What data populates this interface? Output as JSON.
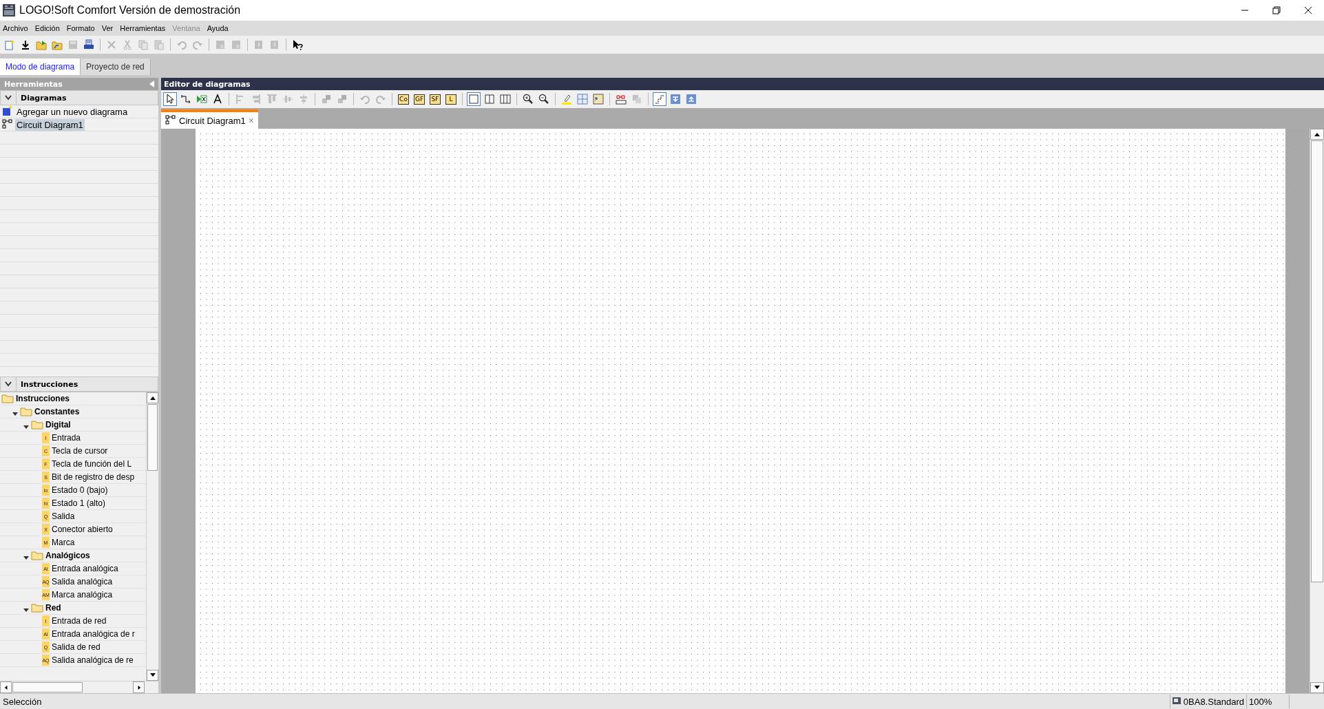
{
  "window": {
    "title": "LOGO!Soft Comfort Versión de demostración"
  },
  "menu": [
    {
      "label": "Archivo",
      "disabled": false
    },
    {
      "label": "Edición",
      "disabled": false
    },
    {
      "label": "Formato",
      "disabled": false
    },
    {
      "label": "Ver",
      "disabled": false
    },
    {
      "label": "Herramientas",
      "disabled": false
    },
    {
      "label": "Ventana",
      "disabled": true
    },
    {
      "label": "Ayuda",
      "disabled": false
    }
  ],
  "toolbar": [
    {
      "kind": "new",
      "disabled": false
    },
    {
      "kind": "download",
      "disabled": false
    },
    {
      "kind": "open",
      "disabled": false
    },
    {
      "kind": "import",
      "disabled": false
    },
    {
      "kind": "save",
      "disabled": true
    },
    {
      "kind": "print",
      "disabled": false
    },
    {
      "kind": "separator"
    },
    {
      "kind": "delete",
      "disabled": true
    },
    {
      "kind": "cut",
      "disabled": true
    },
    {
      "kind": "copy",
      "disabled": true
    },
    {
      "kind": "paste",
      "disabled": true
    },
    {
      "kind": "separator"
    },
    {
      "kind": "undo",
      "disabled": true
    },
    {
      "kind": "redo",
      "disabled": true
    },
    {
      "kind": "separator"
    },
    {
      "kind": "block",
      "disabled": true
    },
    {
      "kind": "block",
      "disabled": true
    },
    {
      "kind": "separator"
    },
    {
      "kind": "transfer",
      "disabled": true
    },
    {
      "kind": "transfer",
      "disabled": true
    },
    {
      "kind": "separator"
    },
    {
      "kind": "help",
      "disabled": false
    }
  ],
  "mode_tabs": [
    {
      "label": "Modo de diagrama",
      "selected": true
    },
    {
      "label": "Proyecto de red",
      "selected": false
    }
  ],
  "tools_panel": {
    "title": "Herramientas",
    "diagrams": {
      "title": "Diagramas",
      "expanded": true,
      "items": [
        {
          "kind": "add",
          "label": "Agregar un nuevo diagrama",
          "selected": false
        },
        {
          "kind": "diagram",
          "label": "Circuit Diagram1",
          "selected": true
        }
      ]
    },
    "instructions": {
      "title": "Instrucciones",
      "expanded": true,
      "tree": [
        {
          "label": "Instrucciones",
          "expanded": true,
          "children": [
            {
              "label": "Constantes",
              "expanded": true,
              "children": [
                {
                  "label": "Digital",
                  "expanded": true,
                  "children": [
                    {
                      "badge": "I",
                      "label": "Entrada"
                    },
                    {
                      "badge": "C",
                      "label": "Tecla de cursor"
                    },
                    {
                      "badge": "F",
                      "label": "Tecla de función del L"
                    },
                    {
                      "badge": "S",
                      "label": "Bit de registro de desp"
                    },
                    {
                      "badge": "lo",
                      "label": "Estado 0 (bajo)"
                    },
                    {
                      "badge": "hi",
                      "label": "Estado 1 (alto)"
                    },
                    {
                      "badge": "Q",
                      "label": "Salida"
                    },
                    {
                      "badge": "X",
                      "label": "Conector abierto"
                    },
                    {
                      "badge": "M",
                      "label": "Marca"
                    }
                  ]
                },
                {
                  "label": "Analógicos",
                  "expanded": true,
                  "children": [
                    {
                      "badge": "AI",
                      "label": "Entrada analógica"
                    },
                    {
                      "badge": "AQ",
                      "label": "Salida analógica"
                    },
                    {
                      "badge": "AM",
                      "label": "Marca analógica"
                    }
                  ]
                },
                {
                  "label": "Red",
                  "expanded": true,
                  "children": [
                    {
                      "badge": "I",
                      "label": "Entrada de red"
                    },
                    {
                      "badge": "AI",
                      "label": "Entrada analógica de r"
                    },
                    {
                      "badge": "Q",
                      "label": "Salida de red"
                    },
                    {
                      "badge": "AQ",
                      "label": "Salida analógica de re"
                    }
                  ]
                }
              ]
            }
          ]
        }
      ]
    }
  },
  "editor": {
    "title": "Editor de diagramas",
    "toolbar": [
      {
        "kind": "select",
        "selected": true,
        "disabled": false
      },
      {
        "kind": "connect",
        "selected": false,
        "disabled": false
      },
      {
        "kind": "insert",
        "selected": false,
        "disabled": false
      },
      {
        "kind": "text-tool",
        "selected": false,
        "disabled": false
      },
      {
        "kind": "separator"
      },
      {
        "kind": "align-left",
        "selected": false,
        "disabled": true
      },
      {
        "kind": "align-right",
        "selected": false,
        "disabled": true
      },
      {
        "kind": "align-top",
        "selected": false,
        "disabled": true
      },
      {
        "kind": "align-middle",
        "selected": false,
        "disabled": true
      },
      {
        "kind": "align-center",
        "selected": false,
        "disabled": true
      },
      {
        "kind": "separator"
      },
      {
        "kind": "arrange",
        "selected": false,
        "disabled": true
      },
      {
        "kind": "arrange",
        "selected": false,
        "disabled": true
      },
      {
        "kind": "separator"
      },
      {
        "kind": "undo",
        "selected": false,
        "disabled": true
      },
      {
        "kind": "redo",
        "selected": false,
        "disabled": true
      },
      {
        "kind": "separator"
      },
      {
        "kind": "label",
        "label": "Co",
        "selected": false,
        "disabled": false
      },
      {
        "kind": "label",
        "label": "GF",
        "selected": false,
        "disabled": false
      },
      {
        "kind": "label",
        "label": "SF",
        "selected": false,
        "disabled": false
      },
      {
        "kind": "label",
        "label": "L",
        "selected": false,
        "disabled": false
      },
      {
        "kind": "separator"
      },
      {
        "kind": "view-one",
        "selected": true,
        "disabled": false
      },
      {
        "kind": "view-two",
        "selected": false,
        "disabled": false
      },
      {
        "kind": "view-three",
        "selected": false,
        "disabled": false
      },
      {
        "kind": "separator"
      },
      {
        "kind": "zoom-in",
        "selected": false,
        "disabled": false
      },
      {
        "kind": "zoom-out",
        "selected": false,
        "disabled": false
      },
      {
        "kind": "separator"
      },
      {
        "kind": "highlight",
        "selected": false,
        "disabled": false
      },
      {
        "kind": "numbering",
        "selected": false,
        "disabled": false
      },
      {
        "kind": "parameters",
        "selected": false,
        "disabled": false
      },
      {
        "kind": "separator"
      },
      {
        "kind": "simulation",
        "selected": false,
        "disabled": false
      },
      {
        "kind": "online",
        "selected": false,
        "disabled": true
      },
      {
        "kind": "separator"
      },
      {
        "kind": "wire-route",
        "selected": true,
        "disabled": false
      },
      {
        "kind": "move-down",
        "selected": false,
        "disabled": false
      },
      {
        "kind": "move-up",
        "selected": false,
        "disabled": false
      }
    ],
    "tabs": [
      {
        "label": "Circuit Diagram1",
        "selected": true,
        "close": "×"
      }
    ]
  },
  "status_bar": {
    "message": "Selección",
    "device": "0BA8.Standard",
    "zoom": "100%"
  }
}
